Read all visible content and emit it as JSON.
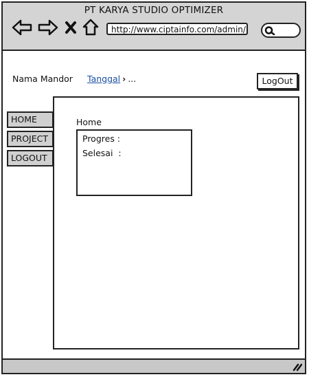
{
  "window": {
    "title": "PT KARYA STUDIO OPTIMIZER",
    "url": "http://www.ciptainfo.com/admin/"
  },
  "header": {
    "mandor_label": "Nama Mandor",
    "breadcrumb_link": "Tanggal",
    "breadcrumb_separator": "›",
    "breadcrumb_rest": "...",
    "logout_button": "LogOut"
  },
  "sidebar": {
    "items": [
      {
        "label": "HOME"
      },
      {
        "label": "PROJECT"
      },
      {
        "label": "LOGOUT"
      }
    ]
  },
  "main": {
    "title": "Home",
    "progress_label": "Progres :",
    "done_label": "Selesai  :"
  }
}
